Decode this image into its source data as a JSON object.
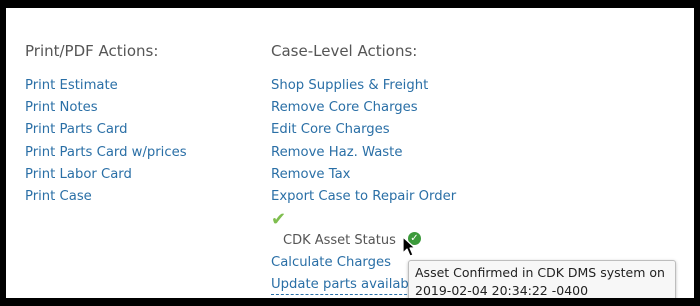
{
  "print_actions": {
    "heading": "Print/PDF Actions:",
    "links": [
      "Print Estimate",
      "Print Notes",
      "Print Parts Card",
      "Print Parts Card w/prices",
      "Print Labor Card",
      "Print Case"
    ]
  },
  "case_actions": {
    "heading": "Case-Level Actions:",
    "links": [
      "Shop Supplies & Freight",
      "Remove Core Charges",
      "Edit Core Charges",
      "Remove Haz. Waste",
      "Remove Tax",
      "Export Case to Repair Order"
    ],
    "asset_status_label": "CDK Asset Status",
    "after_links": [
      "Calculate Charges",
      "Update parts availabi"
    ]
  },
  "tooltip": {
    "line1": "Asset Confirmed in CDK DMS system on",
    "line2": "2019-02-04 20:34:22 -0400"
  },
  "colors": {
    "link": "#2a6fa6",
    "check_light": "#7fbe4f",
    "check_status": "#3c9a3b"
  }
}
